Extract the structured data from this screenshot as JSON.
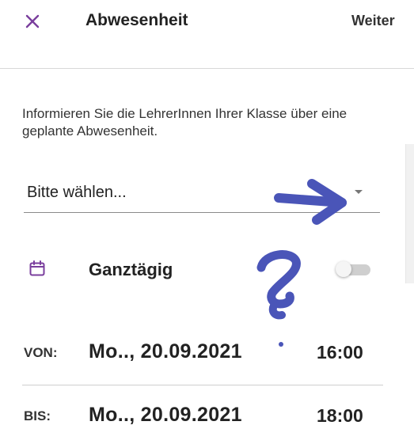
{
  "header": {
    "title": "Abwesenheit",
    "next_label": "Weiter"
  },
  "info_text": "Informieren Sie die LehrerInnen Ihrer Klasse über eine geplante Abwesenheit.",
  "reason_select": {
    "value": "Bitte wählen..."
  },
  "all_day": {
    "label": "Ganztägig",
    "enabled": false
  },
  "from": {
    "label": "VON:",
    "date": "Mo.., 20.09.2021",
    "time": "16:00"
  },
  "to": {
    "label": "BIS:",
    "date": "Mo.., 20.09.2021",
    "time": "18:00"
  },
  "annotations": {
    "color": "#4a55b8",
    "question_mark": "?"
  },
  "colors": {
    "accent": "#7a3e9d",
    "annotation": "#4a55b8"
  }
}
